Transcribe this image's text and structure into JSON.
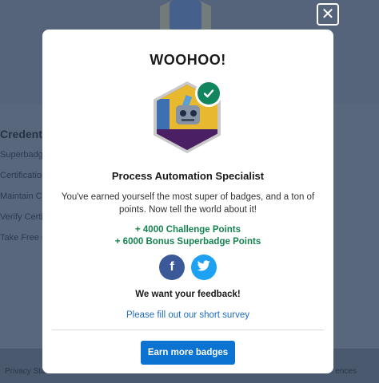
{
  "background": {
    "sidebar_heading": "Credentia",
    "sidebar_links": [
      "Superbadge",
      "Certification",
      "Maintain C",
      "Verify Certi",
      "Take Free C"
    ],
    "footer_left": "Privacy Stat",
    "footer_right": "ences"
  },
  "close": {
    "icon": "close-icon",
    "glyph": "✕"
  },
  "modal": {
    "title": "WOOHOO!",
    "badge_name": "Process Automation Specialist",
    "earned_text": "You've earned yourself the most super of badges, and a ton of points. Now tell the world about it!",
    "points": [
      "+ 4000 Challenge Points",
      "+ 6000 Bonus Superbadge Points"
    ],
    "social": [
      {
        "name": "facebook",
        "icon": "facebook-icon",
        "glyph": "f"
      },
      {
        "name": "twitter",
        "icon": "twitter-icon"
      }
    ],
    "feedback_title": "We want your feedback!",
    "survey_link": "Please fill out our short survey",
    "earn_button": "Earn more badges"
  },
  "colors": {
    "overlay": "#59677d",
    "points_green": "#168350",
    "check_green": "#11855e",
    "link_blue": "#1e6bbf",
    "button_blue": "#0b73d2",
    "facebook": "#3b5998",
    "twitter": "#1da1f2"
  }
}
